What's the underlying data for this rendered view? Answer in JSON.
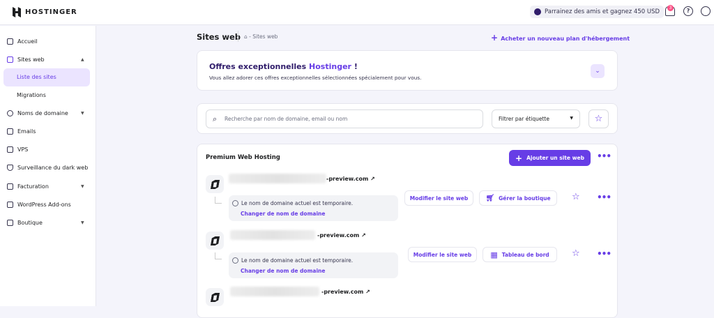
{
  "brand": "HOSTINGER",
  "topbar": {
    "referral": "Parrainez des amis et gagnez 450 USD",
    "notifications_count": "3",
    "help": "?"
  },
  "sidebar": {
    "items": [
      {
        "label": "Accueil"
      },
      {
        "label": "Sites web"
      },
      {
        "label": "Liste des sites"
      },
      {
        "label": "Migrations"
      },
      {
        "label": "Noms de domaine"
      },
      {
        "label": "Emails"
      },
      {
        "label": "VPS"
      },
      {
        "label": "Surveillance du dark web"
      },
      {
        "label": "Facturation"
      },
      {
        "label": "WordPress Add-ons"
      },
      {
        "label": "Boutique"
      }
    ]
  },
  "header": {
    "title": "Sites web",
    "breadcrumb": "- Sites web",
    "buy_plan": "Acheter un nouveau plan d'hébergement"
  },
  "offers": {
    "title": "Offres exceptionnelles",
    "brand": "Hostinger",
    "suffix": " !",
    "subtitle": "Vous allez adorer ces offres exceptionnelles sélectionnées spécialement pour vous."
  },
  "search": {
    "placeholder": "Recherche par nom de domaine, email ou nom",
    "filter": "Filtrer par étiquette"
  },
  "hosting": {
    "title": "Premium Web Hosting",
    "add_site": "Ajouter un site web",
    "sites": [
      {
        "domain": "-preview.com",
        "notice": "Le nom de domaine actuel est temporaire.",
        "change": "Changer de nom de domaine",
        "edit": "Modifier le site web",
        "action": "Gérer la boutique"
      },
      {
        "domain": "-preview.com",
        "notice": "Le nom de domaine actuel est temporaire.",
        "change": "Changer de nom de domaine",
        "edit": "Modifier le site web",
        "action": "Tableau de bord"
      },
      {
        "domain": "-preview.com"
      }
    ]
  }
}
